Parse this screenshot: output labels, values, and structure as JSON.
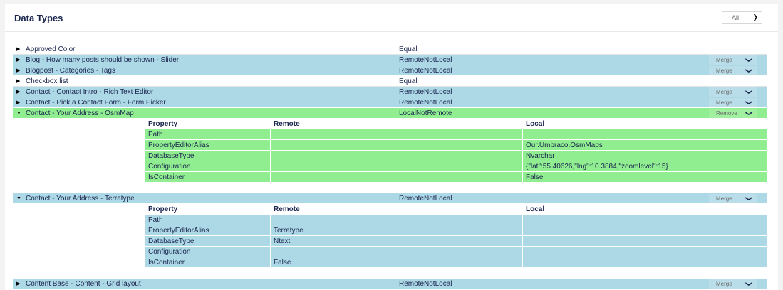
{
  "header": {
    "title": "Data Types",
    "filter_value": "- All -"
  },
  "rows": [
    {
      "name": "Approved Color",
      "status": "Equal",
      "color": "white"
    },
    {
      "name": "Blog - How many posts should be shown - Slider",
      "status": "RemoteNotLocal",
      "color": "blue",
      "action": "Merge"
    },
    {
      "name": "Blogpost - Categories - Tags",
      "status": "RemoteNotLocal",
      "color": "blue",
      "action": "Merge"
    },
    {
      "name": "Checkbox list",
      "status": "Equal",
      "color": "white"
    },
    {
      "name": "Contact - Contact Intro - Rich Text Editor",
      "status": "RemoteNotLocal",
      "color": "blue",
      "action": "Merge"
    },
    {
      "name": "Contact - Pick a Contact Form - Form Picker",
      "status": "RemoteNotLocal",
      "color": "blue",
      "action": "Merge"
    },
    {
      "name": "Contact - Your Address - OsmMap",
      "status": "LocalNotRemote",
      "color": "green",
      "action": "Remove",
      "expanded": true
    },
    {
      "name": "Contact - Your Address - Terratype",
      "status": "RemoteNotLocal",
      "color": "blue",
      "action": "Merge",
      "expanded": true
    },
    {
      "name": "Content Base - Content - Grid layout",
      "status": "RemoteNotLocal",
      "color": "blue",
      "action": "Merge"
    }
  ],
  "details": {
    "headers": {
      "property": "Property",
      "remote": "Remote",
      "local": "Local"
    },
    "osmmap": [
      {
        "property": "Path",
        "remote": "",
        "local": ""
      },
      {
        "property": "PropertyEditorAlias",
        "remote": "",
        "local": "Our.Umbraco.OsmMaps"
      },
      {
        "property": "DatabaseType",
        "remote": "",
        "local": "Nvarchar"
      },
      {
        "property": "Configuration",
        "remote": "",
        "local": "{\"lat\":55.40626,\"lng\":10.3884,\"zoomlevel\":15}"
      },
      {
        "property": "IsContainer",
        "remote": "",
        "local": "False"
      }
    ],
    "terratype": [
      {
        "property": "Path",
        "remote": "",
        "local": ""
      },
      {
        "property": "PropertyEditorAlias",
        "remote": "Terratype",
        "local": ""
      },
      {
        "property": "DatabaseType",
        "remote": "Ntext",
        "local": ""
      },
      {
        "property": "Configuration",
        "remote": "",
        "local": ""
      },
      {
        "property": "IsContainer",
        "remote": "False",
        "local": ""
      }
    ]
  },
  "icons": {
    "collapsed": "triangle-right-icon",
    "expanded": "triangle-down-icon",
    "dropdown": "chevron-down-icon"
  },
  "colors": {
    "blue": "#add8e6",
    "green": "#90ee90",
    "text": "#1b264f"
  }
}
